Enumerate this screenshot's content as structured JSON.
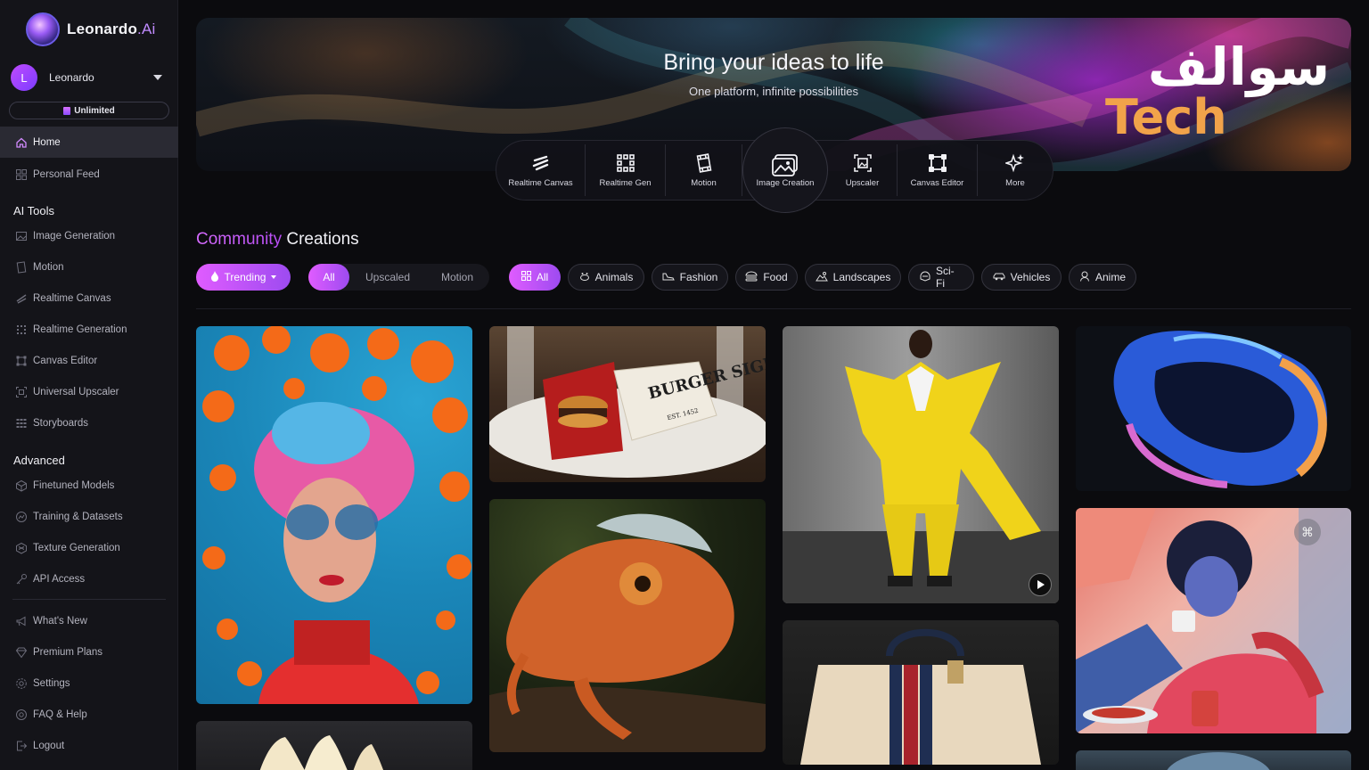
{
  "brand": {
    "name": "Leonardo",
    "suffix": ".Ai"
  },
  "user": {
    "initial": "L",
    "name": "Leonardo"
  },
  "plan": {
    "label": "Unlimited"
  },
  "nav": {
    "main": [
      {
        "label": "Home",
        "icon": "home-icon"
      },
      {
        "label": "Personal Feed",
        "icon": "grid-icon"
      }
    ],
    "ai_tools_heading": "AI Tools",
    "ai_tools": [
      {
        "label": "Image Generation",
        "icon": "image-icon"
      },
      {
        "label": "Motion",
        "icon": "film-icon"
      },
      {
        "label": "Realtime Canvas",
        "icon": "brush-icon"
      },
      {
        "label": "Realtime Generation",
        "icon": "dots-grid-icon"
      },
      {
        "label": "Canvas Editor",
        "icon": "crop-icon"
      },
      {
        "label": "Universal Upscaler",
        "icon": "upscale-icon"
      },
      {
        "label": "Storyboards",
        "icon": "storyboard-icon"
      }
    ],
    "advanced_heading": "Advanced",
    "advanced": [
      {
        "label": "Finetuned Models",
        "icon": "cube-icon"
      },
      {
        "label": "Training & Datasets",
        "icon": "training-icon"
      },
      {
        "label": "Texture Generation",
        "icon": "texture-icon"
      },
      {
        "label": "API Access",
        "icon": "key-icon"
      }
    ],
    "footer": [
      {
        "label": "What's New",
        "icon": "megaphone-icon"
      },
      {
        "label": "Premium Plans",
        "icon": "diamond-icon"
      },
      {
        "label": "Settings",
        "icon": "gear-icon"
      },
      {
        "label": "FAQ & Help",
        "icon": "help-icon"
      },
      {
        "label": "Logout",
        "icon": "logout-icon"
      }
    ]
  },
  "hero": {
    "title": "Bring your ideas to life",
    "subtitle": "One platform, infinite possibilities",
    "tools": [
      {
        "label": "Realtime Canvas",
        "icon": "brush-icon"
      },
      {
        "label": "Realtime Gen",
        "icon": "dots-grid-icon"
      },
      {
        "label": "Motion",
        "icon": "film-icon"
      },
      {
        "label": "Image Creation",
        "icon": "image-icon"
      },
      {
        "label": "Upscaler",
        "icon": "upscale-icon"
      },
      {
        "label": "Canvas Editor",
        "icon": "crop-icon"
      },
      {
        "label": "More",
        "icon": "sparkles-icon"
      }
    ]
  },
  "watermark": {
    "arabic": "سوالف",
    "latin": "Tech"
  },
  "community": {
    "title_accent": "Community",
    "title_rest": "Creations",
    "sort_label": "Trending",
    "type_filters": [
      "All",
      "Upscaled",
      "Motion"
    ],
    "category_filters": [
      {
        "label": "All",
        "icon": "grid-icon"
      },
      {
        "label": "Animals",
        "icon": "paw-icon"
      },
      {
        "label": "Fashion",
        "icon": "shoe-icon"
      },
      {
        "label": "Food",
        "icon": "burger-icon"
      },
      {
        "label": "Landscapes",
        "icon": "landscape-icon"
      },
      {
        "label": "Sci-Fi",
        "icon": "helmet-icon"
      },
      {
        "label": "Vehicles",
        "icon": "car-icon"
      },
      {
        "label": "Anime",
        "icon": "anime-icon"
      }
    ]
  },
  "gallery": {
    "burger_box_text": "BURGER SIGNORE.",
    "burger_box_subtext": "EST. 1452"
  },
  "colors": {
    "accent_start": "#e05cff",
    "accent_end": "#9d4bf0",
    "sidebar_bg": "#141419",
    "page_bg": "#0b0b0e"
  }
}
